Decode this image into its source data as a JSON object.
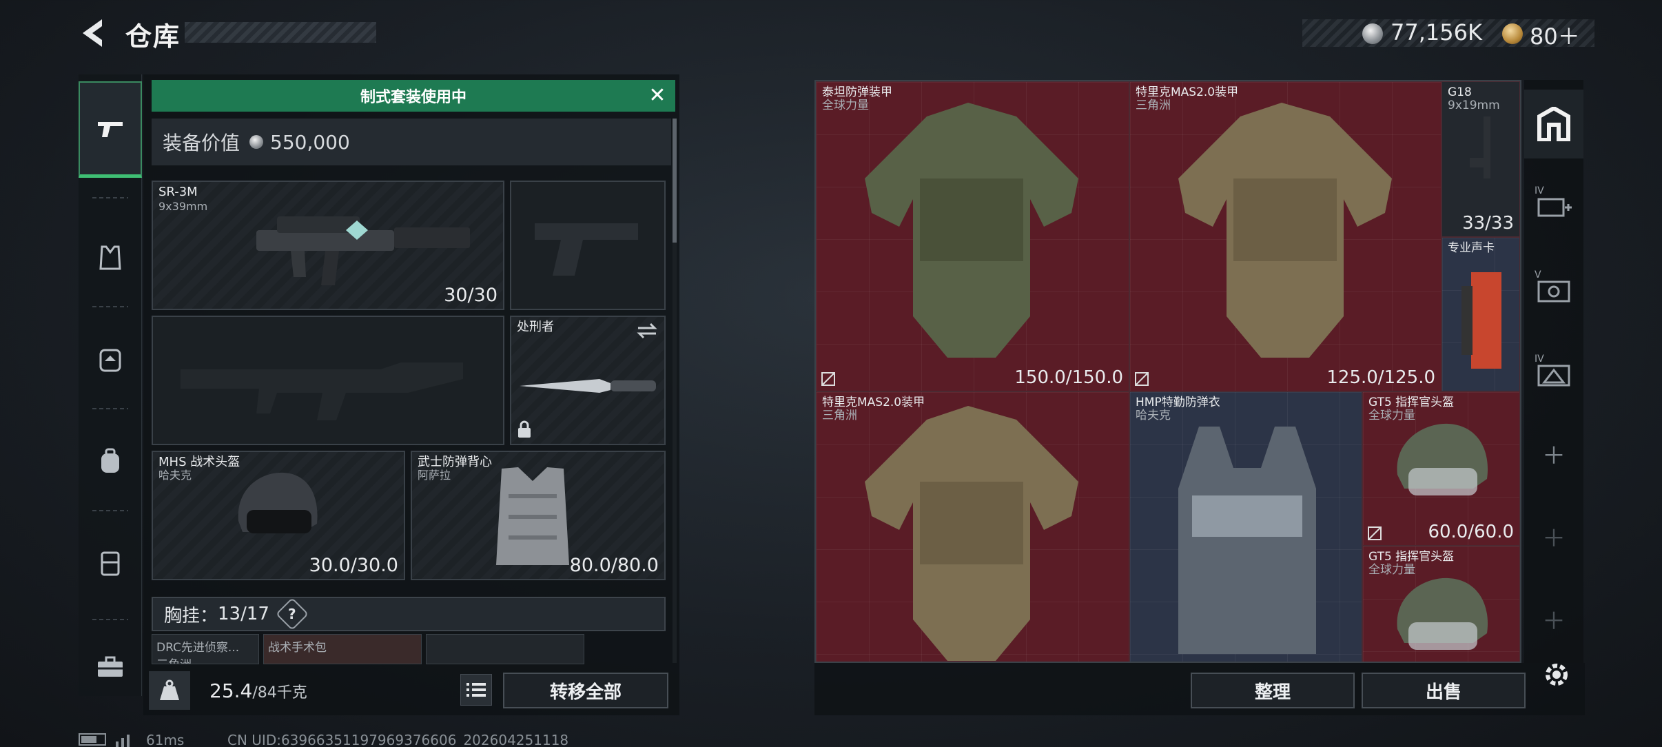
{
  "header": {
    "title": "仓库",
    "money": "77,156K",
    "tokens": "80＋"
  },
  "left_rail": {
    "items": [
      {
        "name": "weapon",
        "icon": "pistol-icon",
        "active": true
      },
      {
        "name": "armor",
        "icon": "vest-icon",
        "active": false
      },
      {
        "name": "chest-rig",
        "icon": "rig-icon",
        "active": false
      },
      {
        "name": "backpack",
        "icon": "backpack-icon",
        "active": false
      },
      {
        "name": "container",
        "icon": "case-icon",
        "active": false
      },
      {
        "name": "toolbox",
        "icon": "toolbox-icon",
        "active": false
      }
    ]
  },
  "loadout": {
    "banner": "制式套装使用中",
    "value_label": "装备价值",
    "value": "550,000",
    "primary": {
      "name": "SR-3M",
      "caliber": "9x39mm",
      "ammo": "30/30"
    },
    "knife": {
      "name": "处刑者"
    },
    "helmet": {
      "name": "MHS 战术头盔",
      "sub": "哈夫克",
      "durability": "30.0/30.0"
    },
    "armor": {
      "name": "武士防弹背心",
      "sub": "阿萨拉",
      "durability": "80.0/80.0"
    },
    "chest_label": "胸挂：",
    "chest_count": "13/17",
    "chest_help": "?",
    "chest_items": [
      "DRC先进侦察...",
      "战术手术包"
    ],
    "chest_item_sub": "三角洲",
    "weight": "25.4",
    "weight_max": "/84千克",
    "transfer_all": "转移全部"
  },
  "storage": {
    "items": [
      {
        "name": "泰坦防弹装甲",
        "sub": "全球力量",
        "value": "150.0/150.0"
      },
      {
        "name": "特里克MAS2.0装甲",
        "sub": "三角洲",
        "value": "125.0/125.0"
      },
      {
        "name": "G18",
        "sub": "9x19mm",
        "value": "33/33"
      },
      {
        "name": "专业声卡",
        "sub": "",
        "value": ""
      },
      {
        "name": "特里克MAS2.0装甲",
        "sub": "三角洲",
        "value": ""
      },
      {
        "name": "HMP特勤防弹衣",
        "sub": "哈夫克",
        "value": ""
      },
      {
        "name": "GT5 指挥官头盔",
        "sub": "全球力量",
        "value": "60.0/60.0"
      },
      {
        "name": "GT5 指挥官头盔",
        "sub": "全球力量",
        "value": ""
      }
    ],
    "sort_label": "整理",
    "sell_label": "出售",
    "roman_labels": [
      "IV",
      "V",
      "IV"
    ]
  },
  "status": {
    "ping": "61ms",
    "uid": "CN UID:6396635119796937660​6_202604251118"
  },
  "colors": {
    "accent_green": "#1e7a52",
    "cell_red": "#5a1c26",
    "cell_blue": "#2c3447"
  }
}
